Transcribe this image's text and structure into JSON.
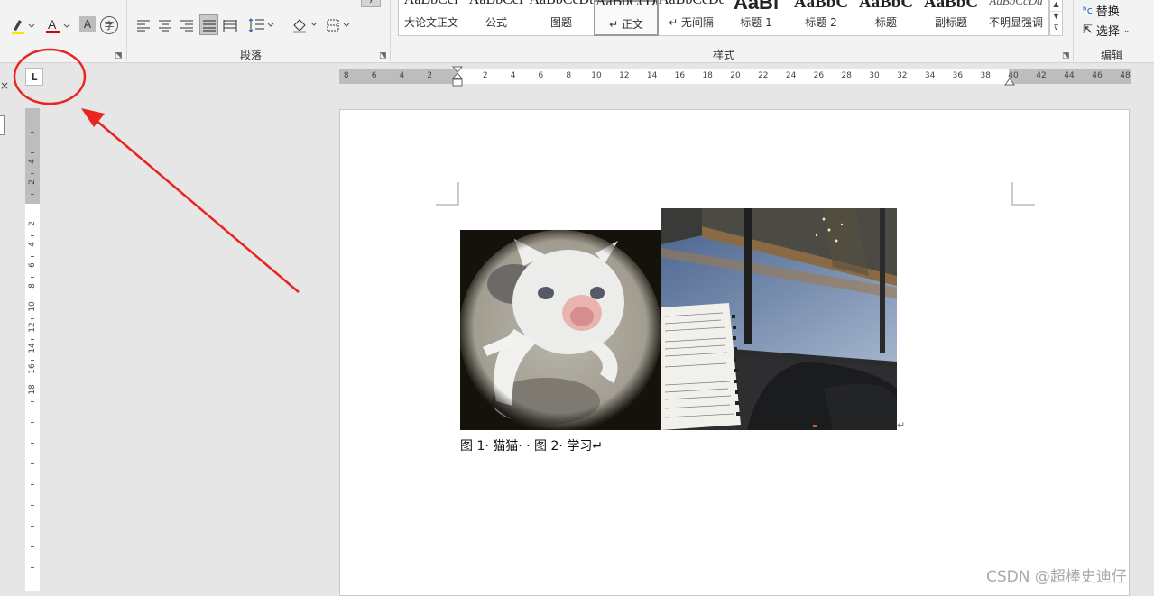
{
  "ribbon": {
    "font_group_icons": [
      "highlight-icon",
      "font-color-icon",
      "char-shading-icon",
      "enclose-char-icon"
    ],
    "font_color_letter": "A",
    "char_shading_letter": "A",
    "enclose_char": "字",
    "paragraph_label": "段落",
    "styles_label": "样式",
    "editing_label": "编辑",
    "styles": [
      {
        "sample": "AaBbCcI",
        "name": "大论文正文",
        "kind": "normal"
      },
      {
        "sample": "AaBbCcI",
        "name": "公式",
        "kind": "normal"
      },
      {
        "sample": "AaBbCcDt",
        "name": "图题",
        "kind": "normal"
      },
      {
        "sample": "AaBbCcDd",
        "name": "↵ 正文",
        "kind": "selected"
      },
      {
        "sample": "AaBbCcDd",
        "name": "↵ 无间隔",
        "kind": "normal"
      },
      {
        "sample": "AaBl",
        "name": "标题 1",
        "kind": "big"
      },
      {
        "sample": "AaBbC",
        "name": "标题 2",
        "kind": "h2"
      },
      {
        "sample": "AaBbC",
        "name": "标题",
        "kind": "h2"
      },
      {
        "sample": "AaBbC",
        "name": "副标题",
        "kind": "h2"
      },
      {
        "sample": "AaBbCcDd",
        "name": "不明显强调",
        "kind": "italic"
      }
    ],
    "replace_label": "替换",
    "select_label": "选择"
  },
  "ruler": {
    "tab_selector_symbol": "L",
    "h_numbers_left": [
      "8",
      "6",
      "4",
      "2"
    ],
    "h_numbers_right": [
      "2",
      "4",
      "6",
      "8",
      "10",
      "12",
      "14",
      "16",
      "18",
      "20",
      "22",
      "24",
      "26",
      "28",
      "30",
      "32",
      "34",
      "36",
      "38"
    ],
    "h_numbers_margin": [
      "40",
      "42",
      "44",
      "46",
      "48"
    ],
    "v_numbers_top": [
      "4",
      "2"
    ],
    "v_numbers": [
      "2",
      "4",
      "6",
      "8",
      "10",
      "12",
      "14",
      "16",
      "18"
    ]
  },
  "document": {
    "image1_alt": "猫猫",
    "image2_alt": "学习",
    "caption": "图 1· 猫猫· · 图 2· 学习↵",
    "image_row_mark": "↵"
  },
  "annotation": {
    "color": "#e8261f"
  },
  "watermark": "CSDN @超棒史迪仔"
}
